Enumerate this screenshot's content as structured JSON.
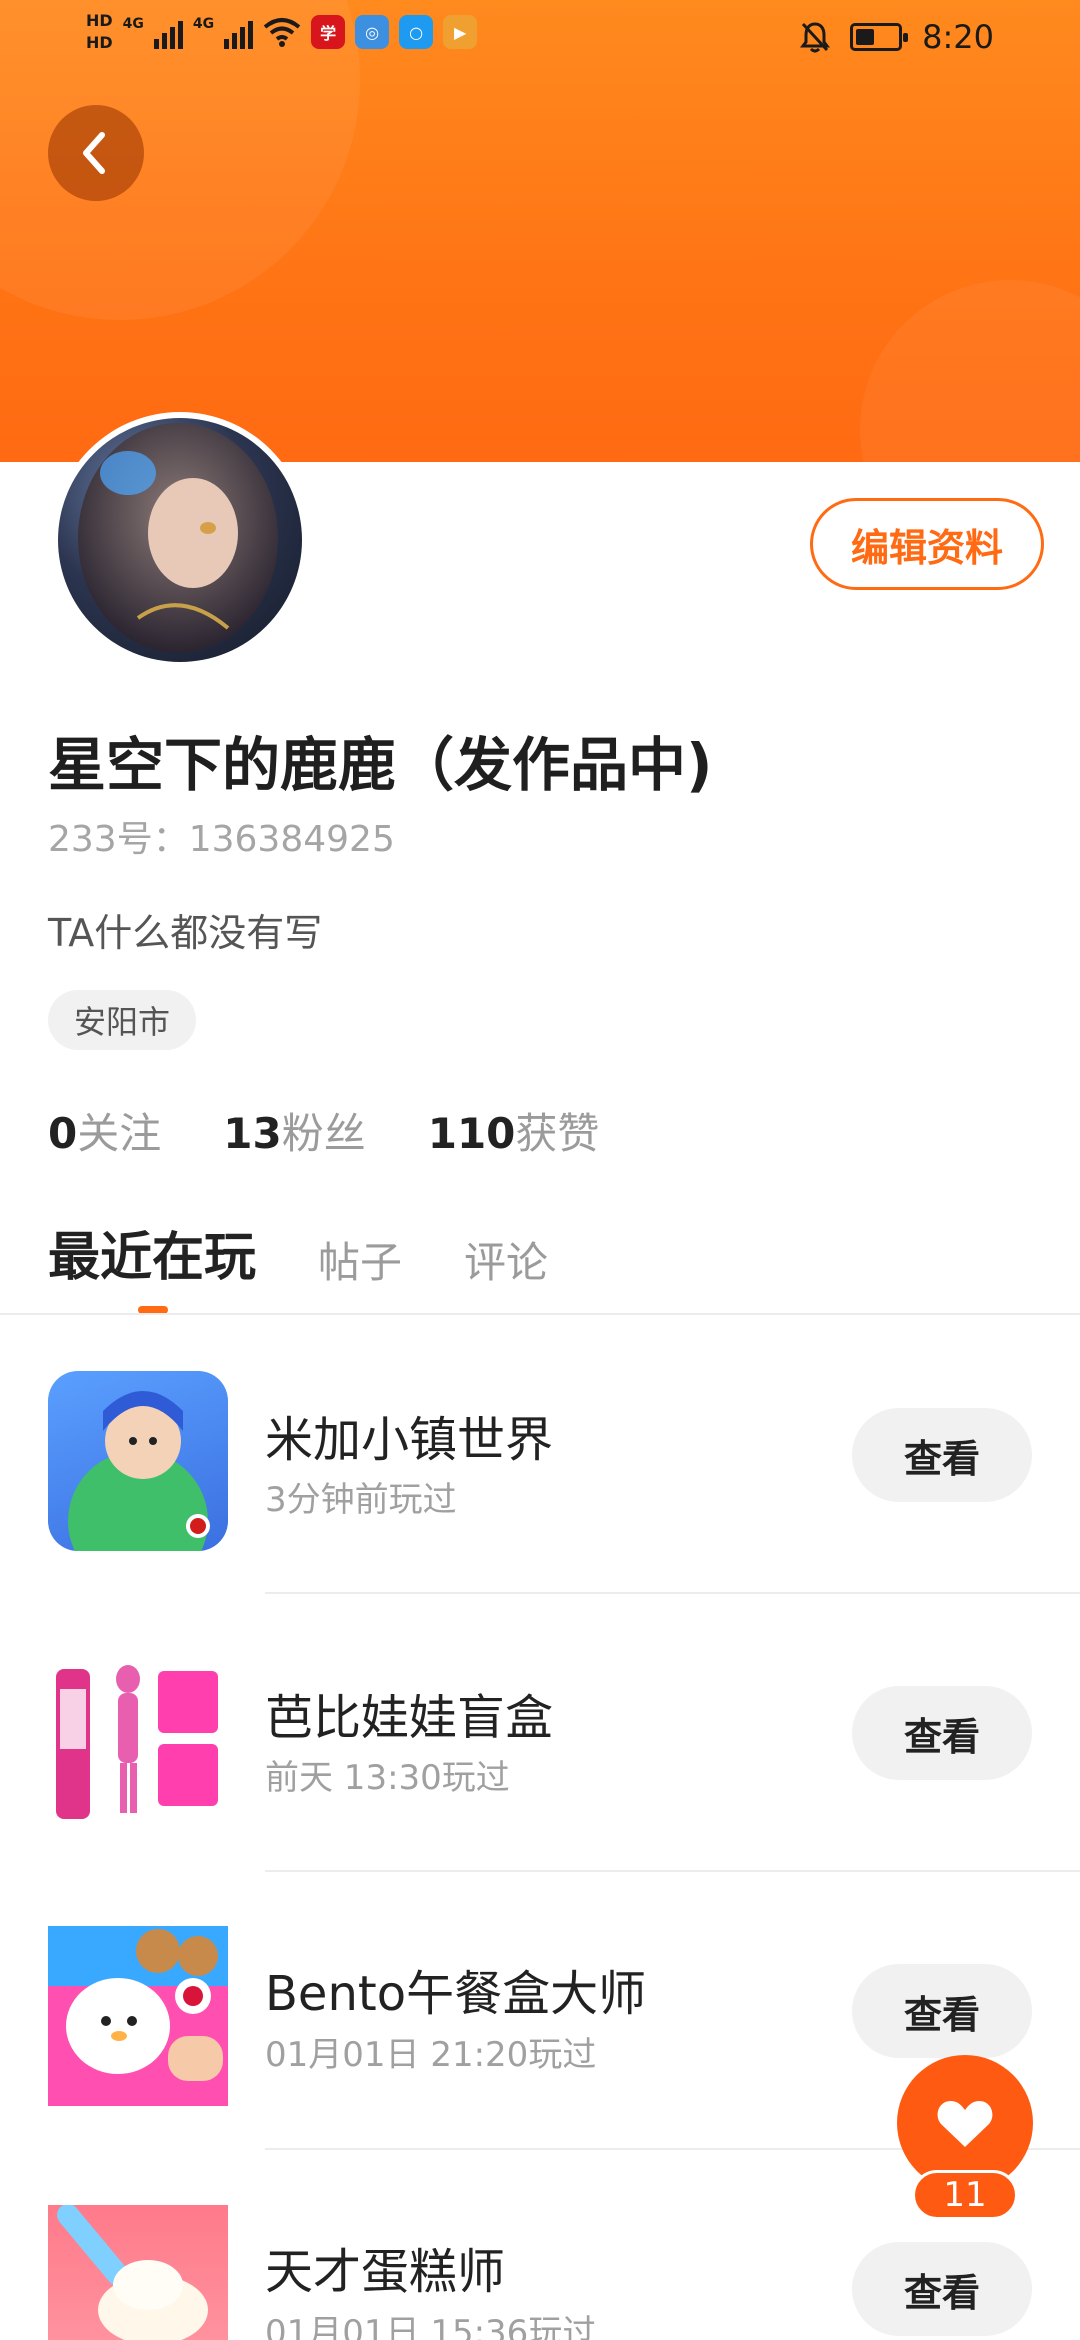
{
  "status_bar": {
    "hd1": "HD",
    "hd2": "HD",
    "net1": "4G",
    "net2": "4G",
    "time": "8:20",
    "battery_level": 0.45
  },
  "profile": {
    "nickname": "星空下的鹿鹿（发作品中)",
    "uid": "233号：136384925",
    "bio": "TA什么都没有写",
    "location": "安阳市",
    "edit_label": "编辑资料",
    "stats": [
      {
        "value": "0",
        "label": "关注"
      },
      {
        "value": "13",
        "label": "粉丝"
      },
      {
        "value": "110",
        "label": "获赞"
      }
    ]
  },
  "tabs": [
    {
      "label": "最近在玩",
      "active": true
    },
    {
      "label": "帖子",
      "active": false
    },
    {
      "label": "评论",
      "active": false
    }
  ],
  "games": [
    {
      "title": "米加小镇世界",
      "time": "3分钟前玩过",
      "button": "查看"
    },
    {
      "title": "芭比娃娃盲盒",
      "time": "前天 13:30玩过",
      "button": "查看"
    },
    {
      "title": "Bento午餐盒大师",
      "time": "01月01日 21:20玩过",
      "button": "查看"
    },
    {
      "title": "天才蛋糕师",
      "time": "01月01日 15:36玩过",
      "button": "查看"
    }
  ],
  "like_fab": {
    "count": "11"
  },
  "colors": {
    "accent": "#ff6a12",
    "header": "#ff7a18"
  }
}
